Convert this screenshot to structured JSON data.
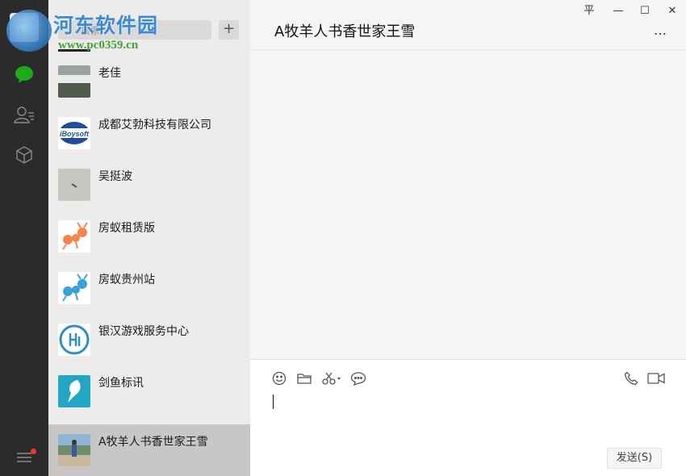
{
  "watermark": {
    "title": "河东软件园",
    "url": "www.pc0359.cn"
  },
  "search": {
    "placeholder": "搜索"
  },
  "list": {
    "add_label": "+",
    "contacts": [
      {
        "name": "老佳"
      },
      {
        "name": "成都艾勃科技有限公司",
        "logo_text": "iBoysoft"
      },
      {
        "name": "吴挺波"
      },
      {
        "name": "房蚁租赁版"
      },
      {
        "name": "房蚁贵州站"
      },
      {
        "name": "银汉游戏服务中心"
      },
      {
        "name": "剑鱼标讯"
      },
      {
        "name": "A牧羊人书香世家王雪",
        "active": true
      }
    ]
  },
  "chat": {
    "title": "A牧羊人书香世家王雪",
    "more": "…",
    "window_controls": {
      "pin": "平",
      "minimize": "—",
      "maximize": "☐",
      "close": "✕"
    },
    "send_label": "发送(S)"
  },
  "colors": {
    "nav_bg": "#2b2b2b",
    "chat_icon": "#1aad19",
    "badge": "#f43530",
    "list_bg": "#eeeceb",
    "active_row": "#c9c7c6"
  },
  "icons": [
    "chat-icon",
    "contacts-icon",
    "cube-icon",
    "menu-icon",
    "emoji-icon",
    "folder-icon",
    "scissors-icon",
    "bubble-icon",
    "phone-icon",
    "video-icon"
  ]
}
